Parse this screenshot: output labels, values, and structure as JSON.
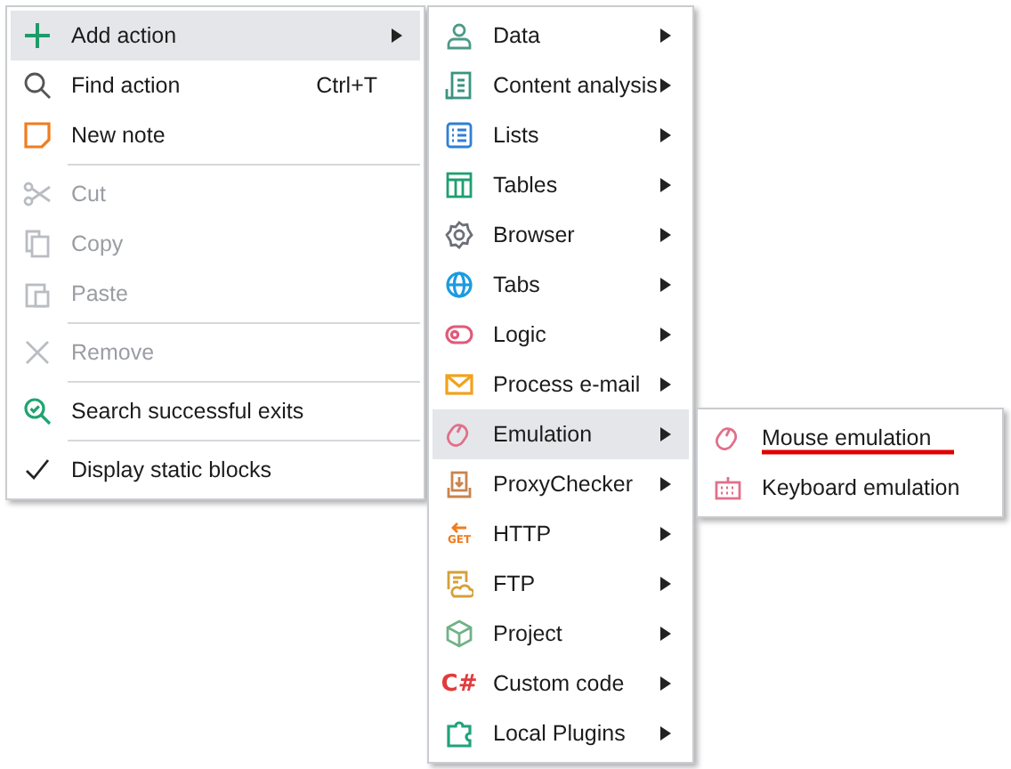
{
  "context_menu": {
    "items": [
      {
        "kind": "item",
        "label": "Add action",
        "disabled": false,
        "selected": true,
        "submenu": true
      },
      {
        "kind": "item",
        "label": "Find action",
        "shortcut": "Ctrl+T",
        "disabled": false,
        "selected": false,
        "submenu": false
      },
      {
        "kind": "item",
        "label": "New note",
        "disabled": false,
        "selected": false,
        "submenu": false
      },
      {
        "kind": "separator"
      },
      {
        "kind": "item",
        "label": "Cut",
        "disabled": true,
        "selected": false,
        "submenu": false
      },
      {
        "kind": "item",
        "label": "Copy",
        "disabled": true,
        "selected": false,
        "submenu": false
      },
      {
        "kind": "item",
        "label": "Paste",
        "disabled": true,
        "selected": false,
        "submenu": false
      },
      {
        "kind": "separator"
      },
      {
        "kind": "item",
        "label": "Remove",
        "disabled": true,
        "selected": false,
        "submenu": false
      },
      {
        "kind": "separator"
      },
      {
        "kind": "item",
        "label": "Search successful exits",
        "disabled": false,
        "selected": false,
        "submenu": false
      },
      {
        "kind": "separator"
      },
      {
        "kind": "check",
        "label": "Display static blocks",
        "disabled": false,
        "selected": false,
        "submenu": false,
        "checked": true
      }
    ]
  },
  "action_submenu": {
    "items": [
      {
        "label": "Data",
        "selected": false,
        "submenu": true
      },
      {
        "label": "Content analysis",
        "selected": false,
        "submenu": true
      },
      {
        "label": "Lists",
        "selected": false,
        "submenu": true
      },
      {
        "label": "Tables",
        "selected": false,
        "submenu": true
      },
      {
        "label": "Browser",
        "selected": false,
        "submenu": true
      },
      {
        "label": "Tabs",
        "selected": false,
        "submenu": true
      },
      {
        "label": "Logic",
        "selected": false,
        "submenu": true
      },
      {
        "label": "Process e-mail",
        "selected": false,
        "submenu": true
      },
      {
        "label": "Emulation",
        "selected": true,
        "submenu": true
      },
      {
        "label": "ProxyChecker",
        "selected": false,
        "submenu": true
      },
      {
        "label": "HTTP",
        "icon_text": "GET",
        "selected": false,
        "submenu": true
      },
      {
        "label": "FTP",
        "selected": false,
        "submenu": true
      },
      {
        "label": "Project",
        "selected": false,
        "submenu": true
      },
      {
        "label": "Custom code",
        "icon_text": "C#",
        "selected": false,
        "submenu": true
      },
      {
        "label": "Local Plugins",
        "selected": false,
        "submenu": true
      }
    ]
  },
  "emulation_submenu": {
    "items": [
      {
        "label": "Mouse emulation",
        "underlined": true
      },
      {
        "label": "Keyboard emulation",
        "underlined": false
      }
    ]
  }
}
